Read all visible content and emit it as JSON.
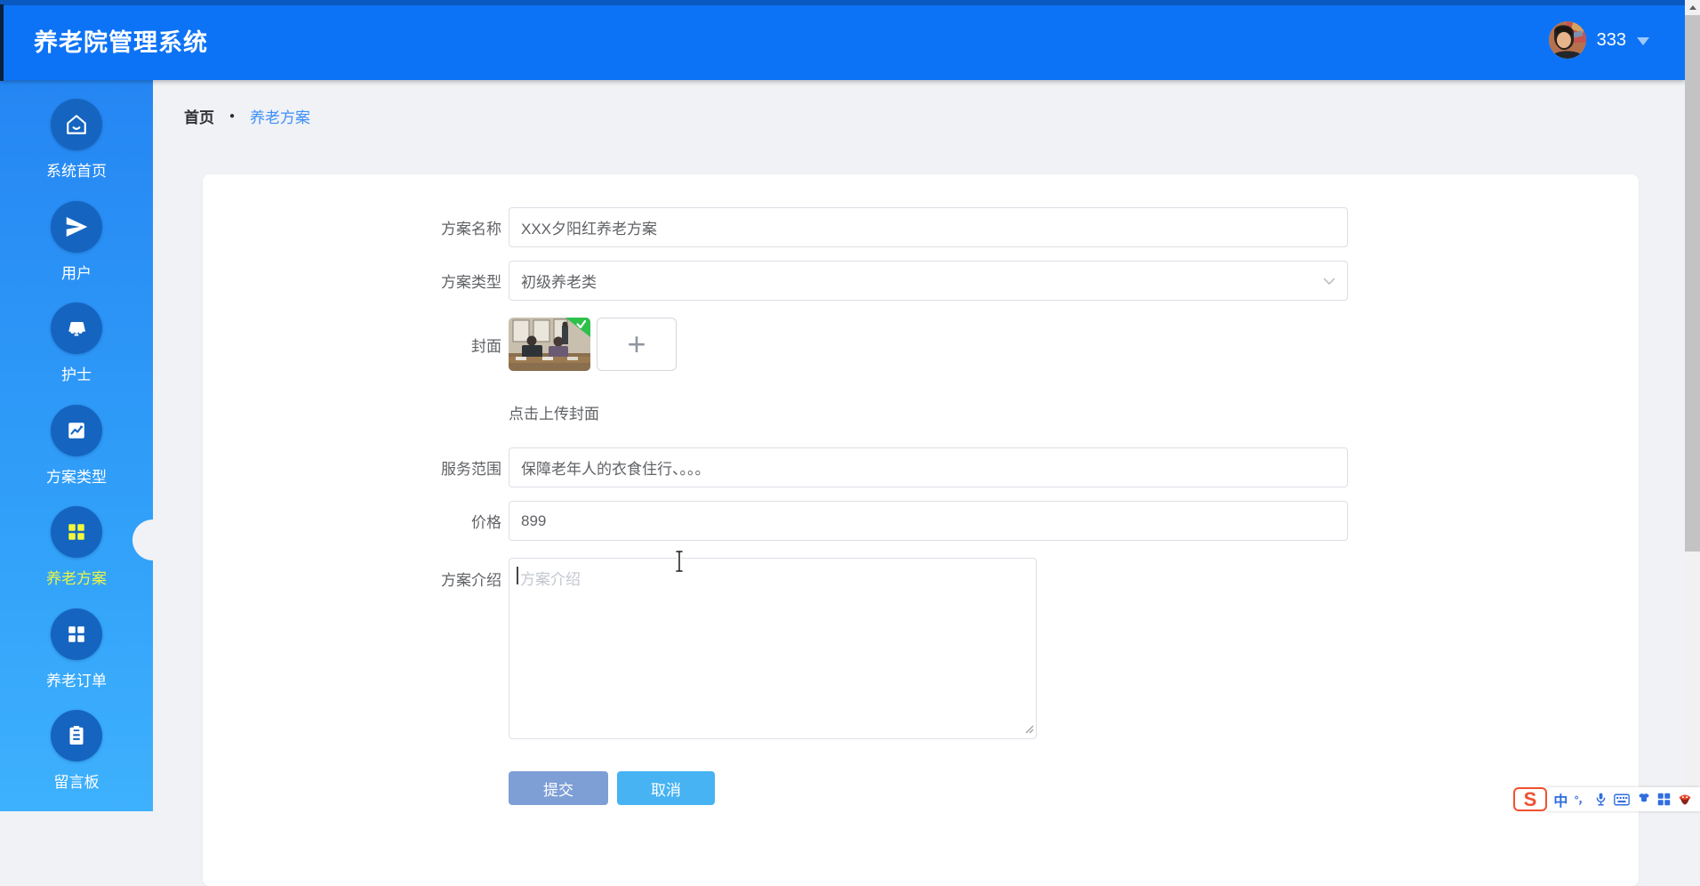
{
  "app": {
    "title": "养老院管理系统"
  },
  "user": {
    "name": "333"
  },
  "breadcrumb": {
    "home": "首页",
    "separator": "●",
    "current": "养老方案"
  },
  "sidebar": {
    "items": [
      {
        "label": "系统首页",
        "icon": "home-icon",
        "active": false
      },
      {
        "label": "用户",
        "icon": "send-icon",
        "active": false
      },
      {
        "label": "护士",
        "icon": "awning-icon",
        "active": false
      },
      {
        "label": "方案类型",
        "icon": "trend-chart-icon",
        "active": false
      },
      {
        "label": "养老方案",
        "icon": "grid-icon",
        "active": true
      },
      {
        "label": "养老订单",
        "icon": "grid-icon",
        "active": false
      },
      {
        "label": "留言板",
        "icon": "clipboard-icon",
        "active": false
      }
    ]
  },
  "form": {
    "name": {
      "label": "方案名称",
      "value": "XXX夕阳红养老方案"
    },
    "type": {
      "label": "方案类型",
      "value": "初级养老类"
    },
    "cover": {
      "label": "封面",
      "hint": "点击上传封面",
      "plus": "+"
    },
    "scope": {
      "label": "服务范围",
      "value": "保障老年人的衣食住行、。。。"
    },
    "price": {
      "label": "价格",
      "value": "899"
    },
    "intro": {
      "label": "方案介绍",
      "placeholder": "方案介绍"
    },
    "submit_label": "提交",
    "cancel_label": "取消"
  },
  "ime": {
    "logo": "S",
    "mode": "中",
    "punct": "°，"
  },
  "colors": {
    "topbar_blue": "#0d73f6",
    "sidebar_top": "#2586f3",
    "sidebar_bottom": "#3eb1fd",
    "icon_circle_blue": "#1565c0",
    "active_yellow": "#e9f643",
    "link_blue": "#3d8ff8",
    "submit_bg": "#7e9fd6",
    "cancel_bg": "#47b3f3",
    "upload_badge_green": "#2dc04b"
  }
}
